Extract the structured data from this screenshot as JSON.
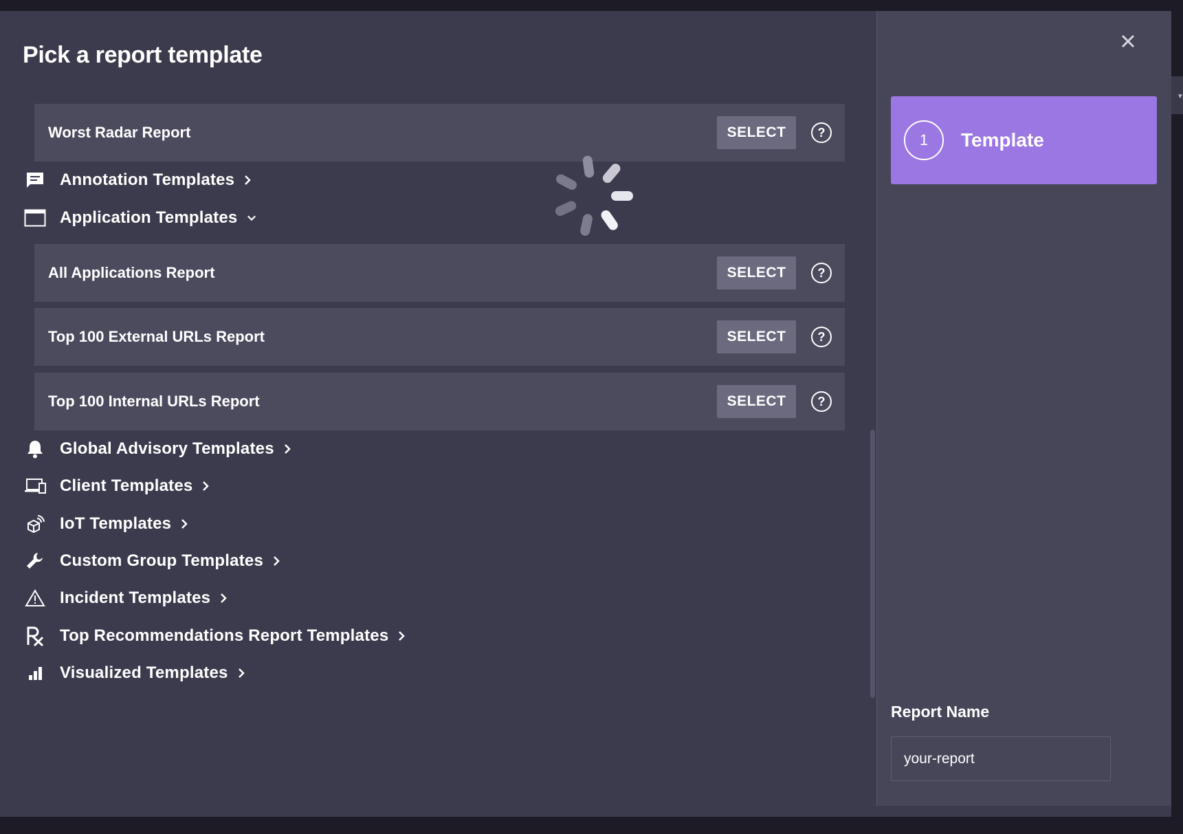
{
  "dialog": {
    "title": "Pick a report template",
    "close_label": "×"
  },
  "buttons": {
    "select_label": "SELECT",
    "help_glyph": "?"
  },
  "templates": {
    "radar": {
      "items": [
        {
          "label": "Worst Radar Report"
        }
      ]
    },
    "annotation": {
      "label": "Annotation Templates",
      "icon": "comment-icon",
      "expanded": false
    },
    "application": {
      "label": "Application Templates",
      "icon": "window-icon",
      "expanded": true,
      "items": [
        {
          "label": "All Applications Report"
        },
        {
          "label": "Top 100 External URLs Report"
        },
        {
          "label": "Top 100 Internal URLs Report"
        }
      ]
    },
    "global_advisory": {
      "label": "Global Advisory Templates",
      "icon": "bell-icon",
      "expanded": false
    },
    "client": {
      "label": "Client Templates",
      "icon": "devices-icon",
      "expanded": false
    },
    "iot": {
      "label": "IoT Templates",
      "icon": "iot-cube-icon",
      "expanded": false
    },
    "custom_group": {
      "label": "Custom Group Templates",
      "icon": "wrench-icon",
      "expanded": false
    },
    "incident": {
      "label": "Incident Templates",
      "icon": "warning-icon",
      "expanded": false
    },
    "top_recommendations": {
      "label": "Top Recommendations Report Templates",
      "icon": "rx-icon",
      "expanded": false
    },
    "visualized": {
      "label": "Visualized Templates",
      "icon": "bar-chart-icon",
      "expanded": false
    }
  },
  "stepper": {
    "step_number": "1",
    "step_label": "Template"
  },
  "report_name": {
    "label": "Report Name",
    "value": "your-report"
  },
  "colors": {
    "dialog_bg": "#3c3b4d",
    "row_bg": "#4c4b5e",
    "button_bg": "#6b6a7f",
    "side_panel_bg": "#474659",
    "accent": "#9b77e3"
  }
}
